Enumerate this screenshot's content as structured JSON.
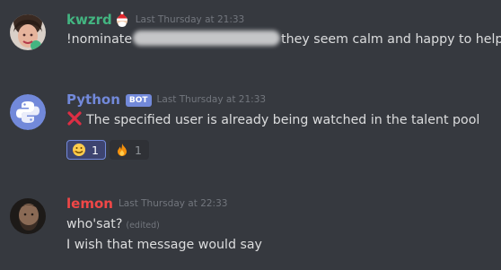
{
  "messages": [
    {
      "username": "kwzrd",
      "username_color": "#43b581",
      "timestamp": "Last Thursday at 21:33",
      "prefix": "!nominate",
      "suffix": "they seem calm and happy to help"
    },
    {
      "username": "Python",
      "username_color": "#7289da",
      "bot_tag": "BOT",
      "timestamp": "Last Thursday at 21:33",
      "text": "The specified user is already being watched in the talent pool",
      "reactions": [
        {
          "emoji": "face-emoji",
          "count": "1",
          "active": true
        },
        {
          "emoji": "fire-emoji",
          "count": "1",
          "active": false
        }
      ]
    },
    {
      "username": "lemon",
      "username_color": "#f04747",
      "timestamp": "Last Thursday at 22:33",
      "line1": "who'sat?",
      "edited": "(edited)",
      "line2": "I wish that message would say"
    }
  ]
}
